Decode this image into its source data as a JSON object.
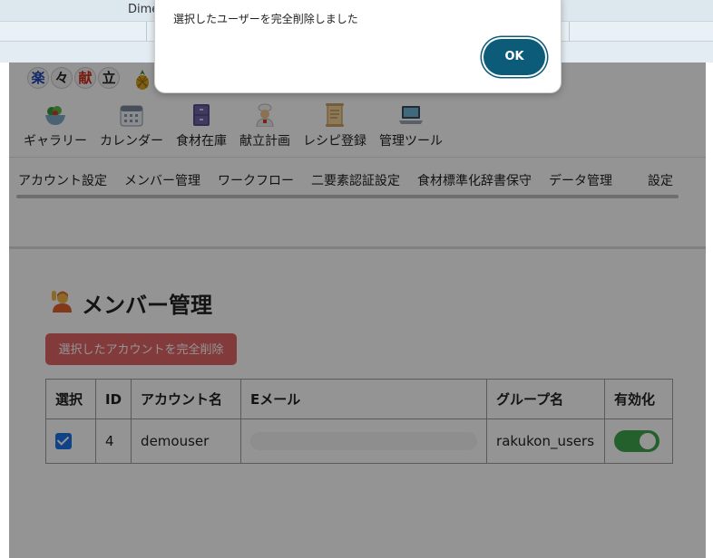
{
  "browser": {
    "title": "Dime"
  },
  "logo": {
    "chars": [
      "楽",
      "々",
      "献",
      "立"
    ]
  },
  "nav": {
    "items": [
      {
        "label": "ギャラリー",
        "icon": "salad-bowl-icon"
      },
      {
        "label": "カレンダー",
        "icon": "calendar-icon"
      },
      {
        "label": "食材在庫",
        "icon": "file-cabinet-icon"
      },
      {
        "label": "献立計画",
        "icon": "chef-icon"
      },
      {
        "label": "レシピ登録",
        "icon": "scroll-icon"
      },
      {
        "label": "管理ツール",
        "icon": "laptop-icon"
      }
    ]
  },
  "subnav": {
    "items": [
      "アカウント設定",
      "メンバー管理",
      "ワークフロー",
      "二要素認証設定",
      "食材標準化辞書保守",
      "データ管理",
      "設定"
    ]
  },
  "main": {
    "title": "メンバー管理",
    "title_icon": "raising-hand-icon",
    "delete_button": "選択したアカウントを完全削除"
  },
  "table": {
    "headers": [
      "選択",
      "ID",
      "アカウント名",
      "Eメール",
      "グループ名",
      "有効化"
    ],
    "rows": [
      {
        "selected": true,
        "id": "4",
        "account": "demouser",
        "email_redacted": true,
        "group": "rakukon_users",
        "enabled": true
      }
    ]
  },
  "dialog": {
    "message": "選択したユーザーを完全削除しました",
    "ok_label": "OK"
  },
  "colors": {
    "accent": "#0c5c79",
    "danger": "#dc4a4a",
    "toggle_on": "#3ea64a",
    "checkbox": "#1a73e8"
  }
}
